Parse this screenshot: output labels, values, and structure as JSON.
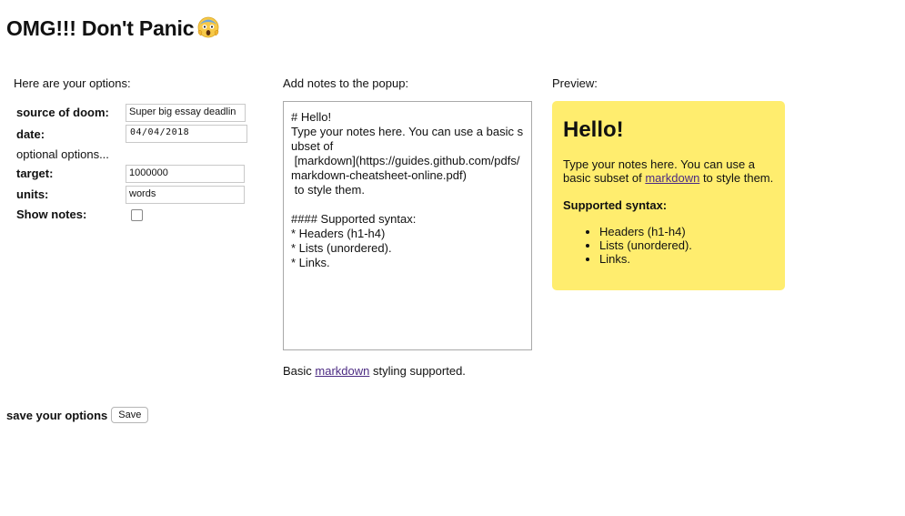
{
  "header": {
    "title": "OMG!!! Don't Panic",
    "emoji": "scared-face-emoji"
  },
  "options": {
    "heading": "Here are your options:",
    "source_label": "source of doom:",
    "source_value": "Super big essay deadlin",
    "date_label": "date:",
    "date_value": "04/04/2018",
    "optional_heading": "optional options...",
    "target_label": "target:",
    "target_value": "1000000",
    "units_label": "units:",
    "units_value": "words",
    "show_notes_label": "Show notes:",
    "show_notes_checked": false
  },
  "notes": {
    "heading": "Add notes to the popup:",
    "text": "# Hello!\nType your notes here. You can use a basic subset of\n [markdown](https://guides.github.com/pdfs/markdown-cheatsheet-online.pdf)\n to style them.\n\n#### Supported syntax:\n* Headers (h1-h4)\n* Lists (unordered).\n* Links.",
    "footer_prefix": "Basic",
    "footer_link": "markdown",
    "footer_suffix": "styling supported."
  },
  "preview": {
    "heading": "Preview:",
    "h1": "Hello!",
    "para_prefix": "Type your notes here. You can use a basic subset of",
    "para_link": "markdown",
    "para_suffix": "to style them.",
    "h4": "Supported syntax:",
    "items": [
      "Headers (h1-h4)",
      "Lists (unordered).",
      "Links."
    ],
    "background": "#ffed6e"
  },
  "footer": {
    "save_label": "save your options",
    "save_button": "Save"
  }
}
